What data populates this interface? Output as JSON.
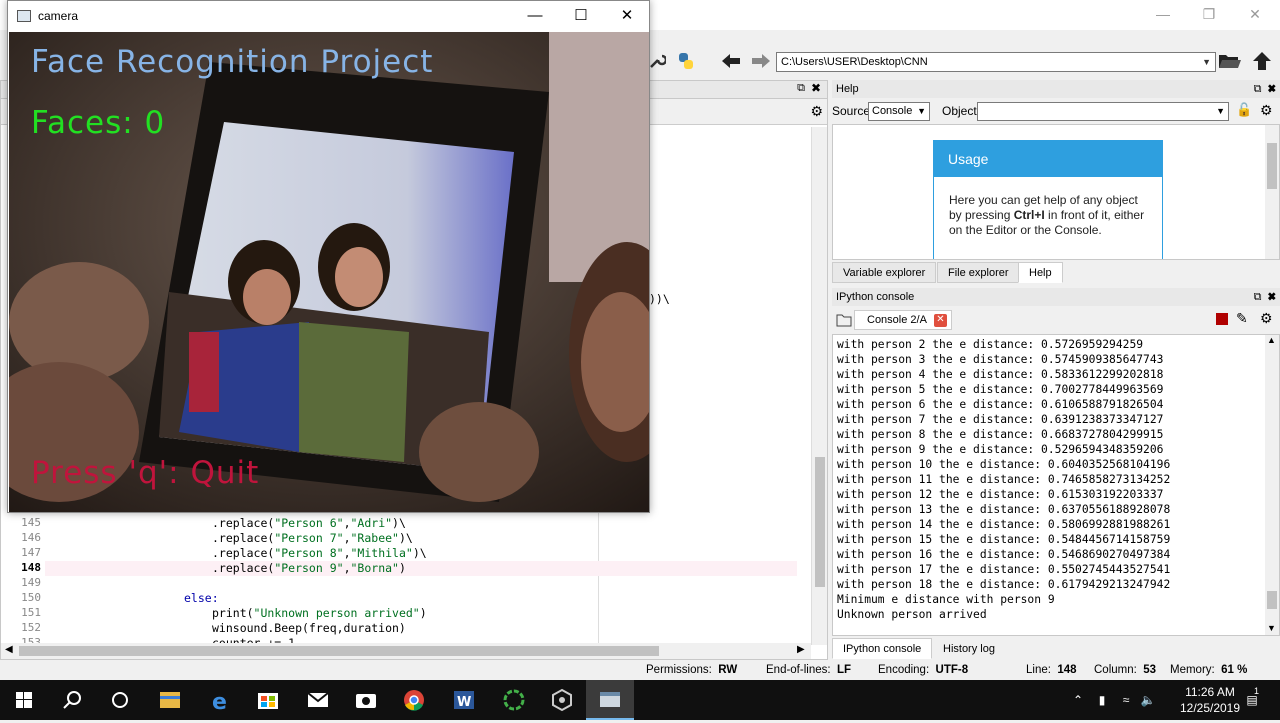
{
  "spyder": {
    "path": "C:\\Users\\USER\\Desktop\\CNN",
    "help": {
      "title": "Help",
      "source_label": "Source",
      "source_value": "Console",
      "object_label": "Object",
      "usage_title": "Usage",
      "usage_text_1": "Here you can get help of any object by pressing ",
      "usage_shortcut": "Ctrl+I",
      "usage_text_2": " in front of it, either on the Editor or the Console.",
      "tabs": [
        "Variable explorer",
        "File explorer",
        "Help"
      ]
    },
    "console": {
      "title": "IPython console",
      "tab_label": "Console 2/A",
      "lines": [
        "with person 2 the e distance: 0.5726959294259",
        "with person 3 the e distance: 0.5745909385647743",
        "with person 4 the e distance: 0.5833612299202818",
        "with person 5 the e distance: 0.7002778449963569",
        "with person 6 the e distance: 0.6106588791826504",
        "with person 7 the e distance: 0.6391238373347127",
        "with person 8 the e distance: 0.6683727804299915",
        "with person 9 the e distance: 0.5296594348359206",
        "with person 10 the e distance: 0.6040352568104196",
        "with person 11 the e distance: 0.7465858273134252",
        "with person 12 the e distance: 0.615303192203337",
        "with person 13 the e distance: 0.6370556188928078",
        "with person 14 the e distance: 0.5806992881988261",
        "with person 15 the e distance: 0.5484456714158759",
        "with person 16 the e distance: 0.5468690270497384",
        "with person 17 the e distance: 0.5502745443527541",
        "with person 18 the e distance: 0.6179429213247942",
        "Minimum e distance with person 9",
        "Unknown person arrived"
      ],
      "bottom_tabs": [
        "IPython console",
        "History log"
      ]
    },
    "editor": {
      "partial_text": "))\\",
      "lines": [
        {
          "num": "145",
          "indent": "            ",
          "pre": ".replace(",
          "a": "\"Person 6\"",
          "sep": ",",
          "b": "\"Adri\"",
          "post": ")\\"
        },
        {
          "num": "146",
          "indent": "            ",
          "pre": ".replace(",
          "a": "\"Person 7\"",
          "sep": ",",
          "b": "\"Rabee\"",
          "post": ")\\"
        },
        {
          "num": "147",
          "indent": "            ",
          "pre": ".replace(",
          "a": "\"Person 8\"",
          "sep": ",",
          "b": "\"Mithila\"",
          "post": ")\\"
        },
        {
          "num": "148",
          "indent": "            ",
          "pre": ".replace(",
          "a": "\"Person 9\"",
          "sep": ",",
          "b": "\"Borna\"",
          "post": ")"
        }
      ],
      "line149": "149",
      "line150": "150",
      "line150_code": "else:",
      "line151": "151",
      "line151_pre": "print(",
      "line151_str": "\"Unknown person arrived\"",
      "line151_post": ")",
      "line152": "152",
      "line152_code": "winsound.Beep(freq,duration)",
      "line153": "153",
      "line153_code": "counter += 1"
    },
    "status": {
      "permissions_label": "Permissions:",
      "permissions_value": "RW",
      "eol_label": "End-of-lines:",
      "eol_value": "LF",
      "encoding_label": "Encoding:",
      "encoding_value": "UTF-8",
      "line_label": "Line:",
      "line_value": "148",
      "column_label": "Column:",
      "column_value": "53",
      "memory_label": "Memory:",
      "memory_value": "61 %"
    }
  },
  "camera": {
    "window_title": "camera",
    "overlay_title": "Face Recognition Project",
    "faces_text": "Faces: 0",
    "quit_text": "Press 'q': Quit",
    "title_color": "#87b4e6",
    "faces_color": "#22e022",
    "quit_color": "#c0143c"
  },
  "taskbar": {
    "time": "11:26 AM",
    "date": "12/25/2019",
    "notification_count": "1"
  }
}
